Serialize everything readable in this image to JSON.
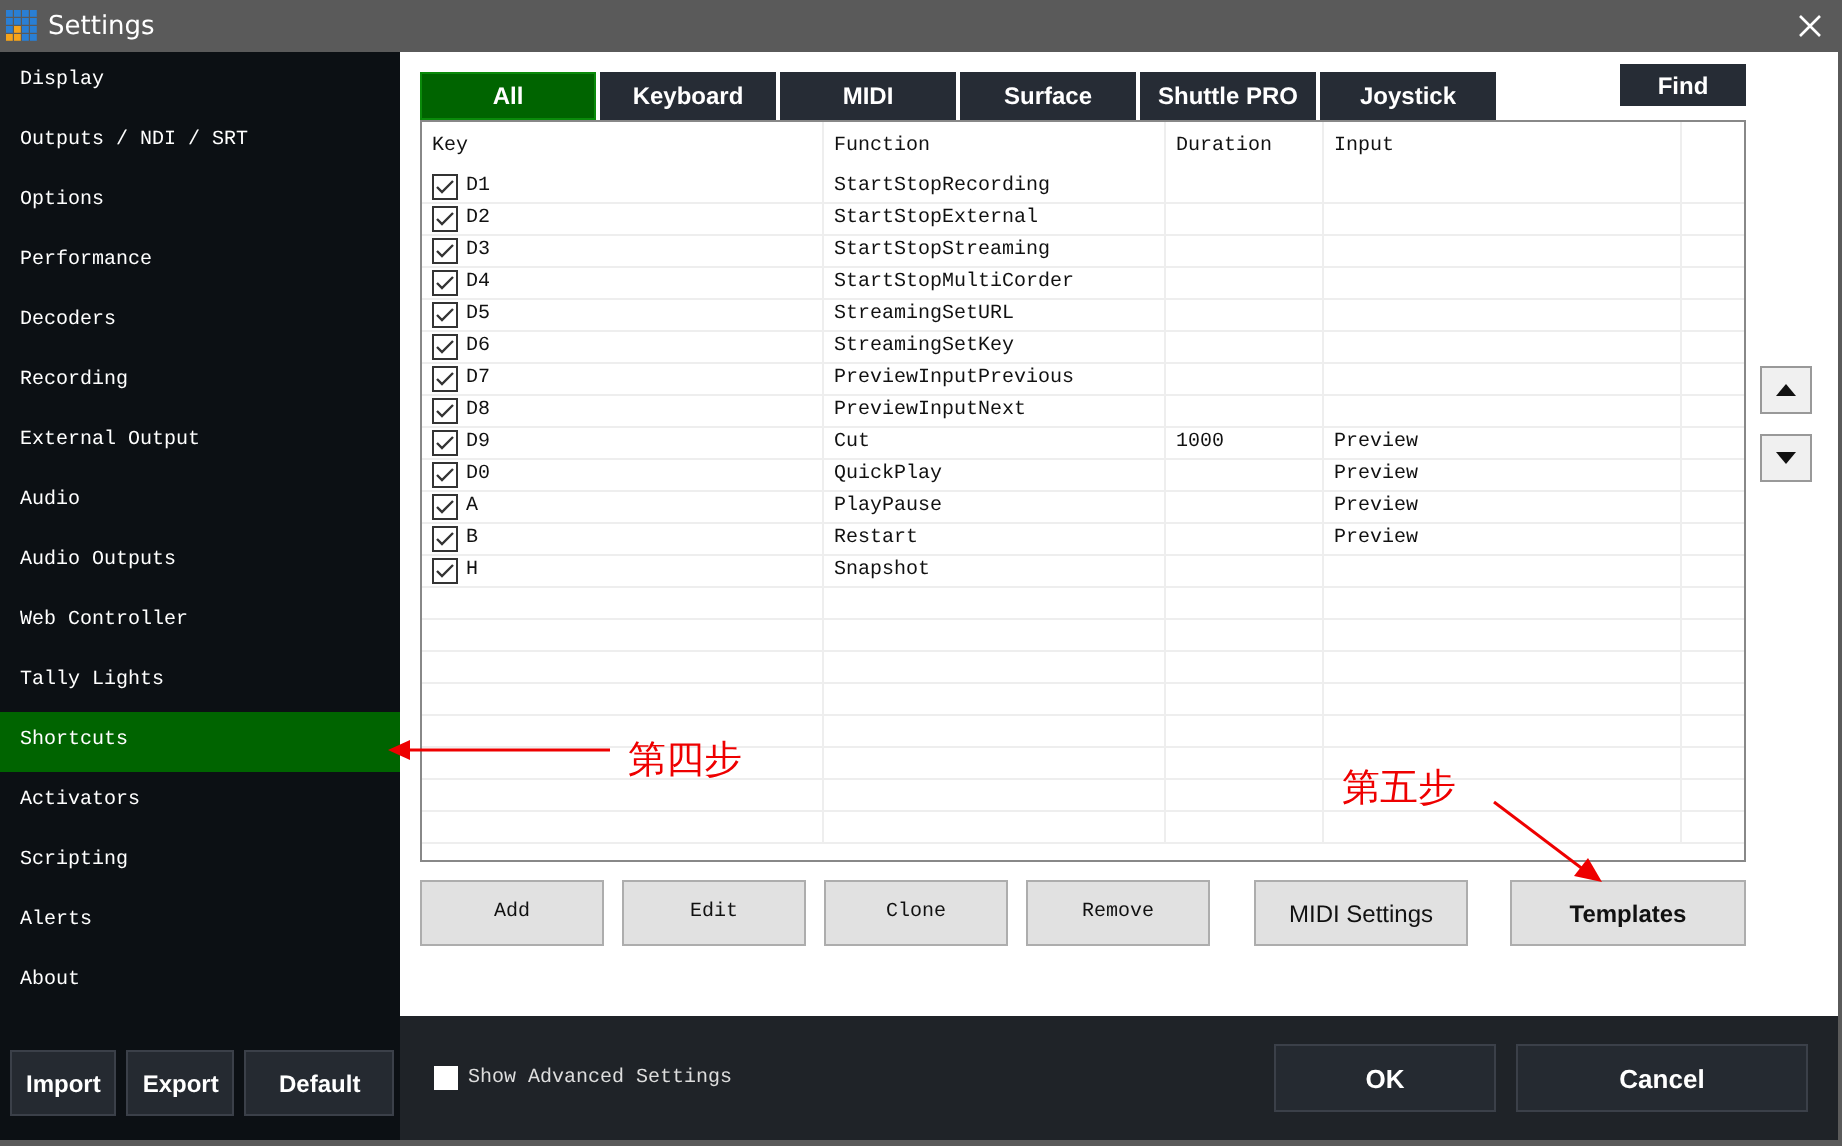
{
  "window": {
    "title": "Settings"
  },
  "sidebar": {
    "items": [
      {
        "label": "Display",
        "selected": false
      },
      {
        "label": "Outputs / NDI / SRT",
        "selected": false
      },
      {
        "label": "Options",
        "selected": false
      },
      {
        "label": "Performance",
        "selected": false
      },
      {
        "label": "Decoders",
        "selected": false
      },
      {
        "label": "Recording",
        "selected": false
      },
      {
        "label": "External Output",
        "selected": false
      },
      {
        "label": "Audio",
        "selected": false
      },
      {
        "label": "Audio Outputs",
        "selected": false
      },
      {
        "label": "Web Controller",
        "selected": false
      },
      {
        "label": "Tally Lights",
        "selected": false
      },
      {
        "label": "Shortcuts",
        "selected": true
      },
      {
        "label": "Activators",
        "selected": false
      },
      {
        "label": "Scripting",
        "selected": false
      },
      {
        "label": "Alerts",
        "selected": false
      },
      {
        "label": "About",
        "selected": false
      }
    ],
    "buttons": [
      "Import",
      "Export",
      "Default"
    ]
  },
  "tabs": [
    {
      "label": "All",
      "selected": true
    },
    {
      "label": "Keyboard",
      "selected": false
    },
    {
      "label": "MIDI",
      "selected": false
    },
    {
      "label": "Surface",
      "selected": false
    },
    {
      "label": "Shuttle PRO",
      "selected": false
    },
    {
      "label": "Joystick",
      "selected": false
    }
  ],
  "find_button": "Find",
  "table": {
    "columns": [
      "Key",
      "Function",
      "Duration",
      "Input"
    ],
    "rows": [
      {
        "checked": true,
        "key": "D1",
        "function": "StartStopRecording",
        "duration": "",
        "input": ""
      },
      {
        "checked": true,
        "key": "D2",
        "function": "StartStopExternal",
        "duration": "",
        "input": ""
      },
      {
        "checked": true,
        "key": "D3",
        "function": "StartStopStreaming",
        "duration": "",
        "input": ""
      },
      {
        "checked": true,
        "key": "D4",
        "function": "StartStopMultiCorder",
        "duration": "",
        "input": ""
      },
      {
        "checked": true,
        "key": "D5",
        "function": "StreamingSetURL",
        "duration": "",
        "input": ""
      },
      {
        "checked": true,
        "key": "D6",
        "function": "StreamingSetKey",
        "duration": "",
        "input": ""
      },
      {
        "checked": true,
        "key": "D7",
        "function": "PreviewInputPrevious",
        "duration": "",
        "input": ""
      },
      {
        "checked": true,
        "key": "D8",
        "function": "PreviewInputNext",
        "duration": "",
        "input": ""
      },
      {
        "checked": true,
        "key": "D9",
        "function": "Cut",
        "duration": "1000",
        "input": "Preview"
      },
      {
        "checked": true,
        "key": "D0",
        "function": "QuickPlay",
        "duration": "",
        "input": "Preview"
      },
      {
        "checked": true,
        "key": "A",
        "function": "PlayPause",
        "duration": "",
        "input": "Preview"
      },
      {
        "checked": true,
        "key": "B",
        "function": "Restart",
        "duration": "",
        "input": "Preview"
      },
      {
        "checked": true,
        "key": "H",
        "function": "Snapshot",
        "duration": "",
        "input": ""
      }
    ]
  },
  "action_buttons": [
    "Add",
    "Edit",
    "Clone",
    "Remove"
  ],
  "midi_settings_button": "MIDI Settings",
  "templates_button": "Templates",
  "show_advanced_settings": {
    "label": "Show Advanced Settings",
    "checked": false
  },
  "footer_buttons": [
    "OK",
    "Cancel"
  ],
  "annotations": [
    {
      "label": "第四步",
      "kind": "left"
    },
    {
      "label": "第五步",
      "kind": "down"
    }
  ]
}
